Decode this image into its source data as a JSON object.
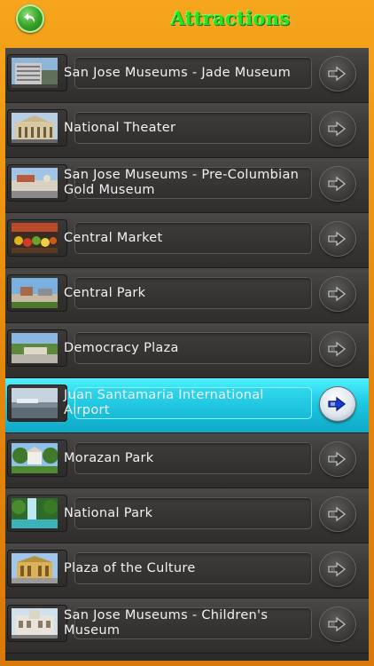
{
  "header": {
    "title": "Attractions"
  },
  "attractions": [
    {
      "name": "San Jose Museums - Jade Museum",
      "photo": "jade-museum"
    },
    {
      "name": "National Theater",
      "photo": "national-theater"
    },
    {
      "name": "San Jose Museums - Pre-Columbian Gold Museum",
      "photo": "gold-museum"
    },
    {
      "name": "Central Market",
      "photo": "central-market"
    },
    {
      "name": "Central Park",
      "photo": "central-park"
    },
    {
      "name": "Democracy Plaza",
      "photo": "democracy-plaza"
    },
    {
      "name": "Juan Santamaria International Airport",
      "photo": "airport",
      "selected": true
    },
    {
      "name": "Morazan Park",
      "photo": "morazan-park"
    },
    {
      "name": "National Park",
      "photo": "national-park"
    },
    {
      "name": "Plaza of the Culture",
      "photo": "plaza-culture"
    },
    {
      "name": "San Jose Museums - Children's Museum",
      "photo": "childrens-museum"
    }
  ],
  "colors": {
    "frame": "#e58a0d",
    "title": "#29e31e",
    "selected_row": "#1ec9e2"
  }
}
